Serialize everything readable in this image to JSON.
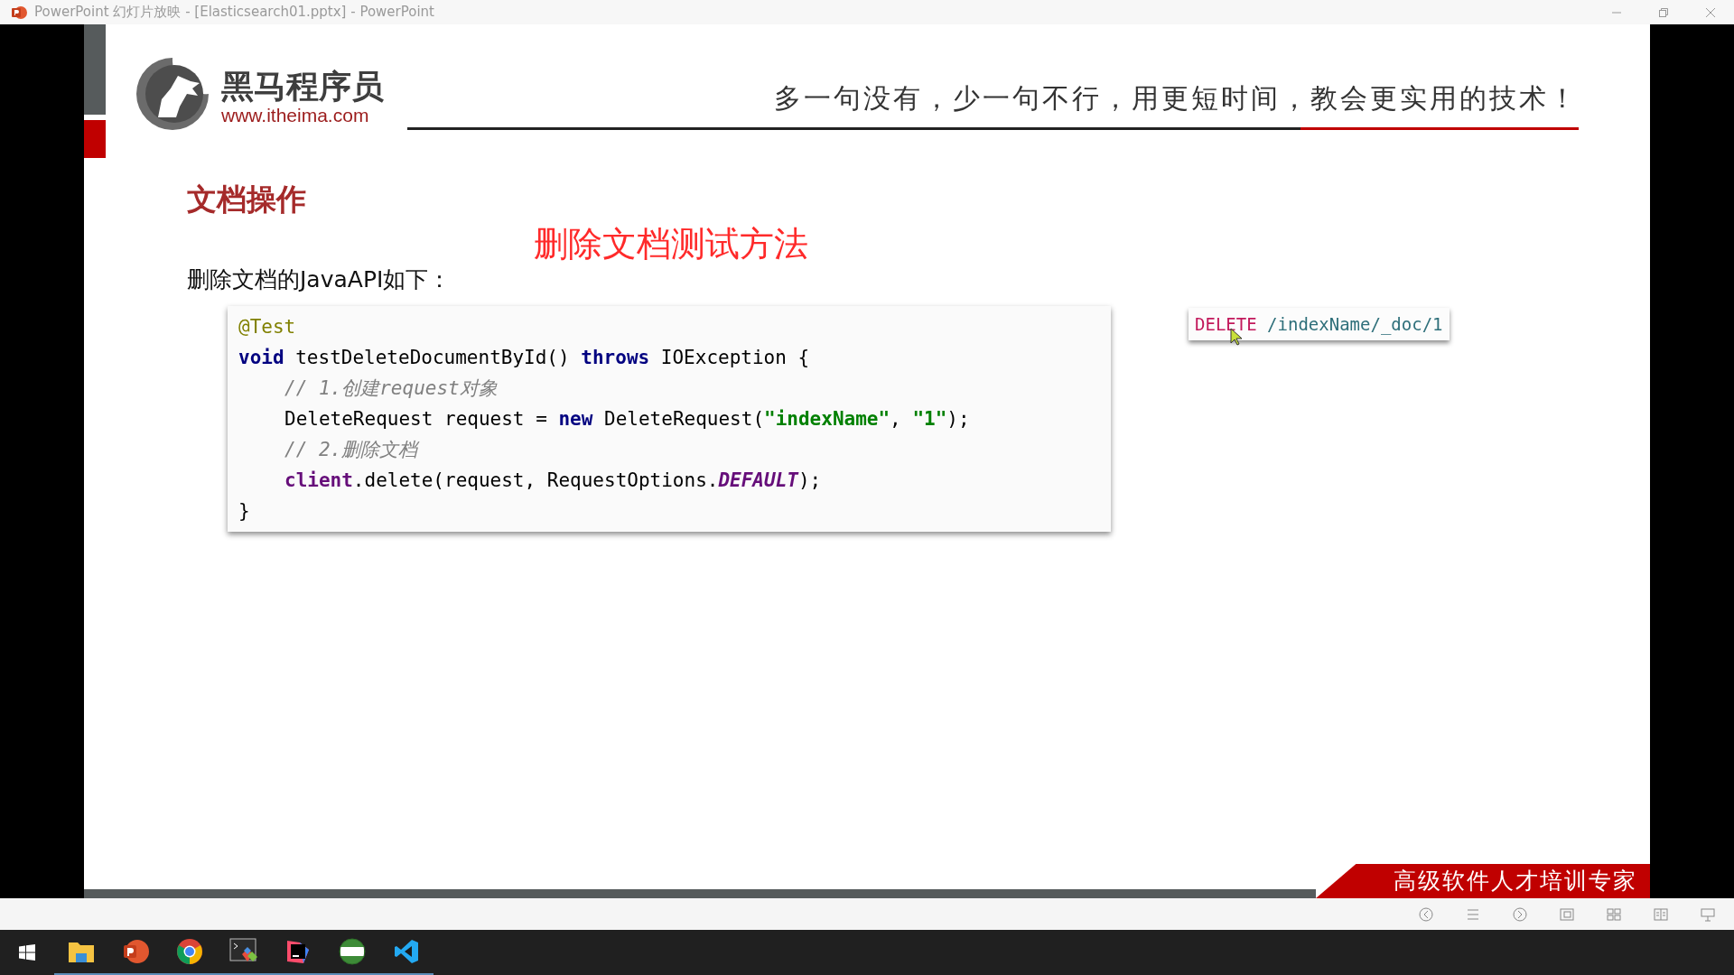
{
  "window": {
    "title": "PowerPoint 幻灯片放映 - [Elasticsearch01.pptx] - PowerPoint"
  },
  "slide": {
    "brand_name": "黑马程序员",
    "brand_url": "www.itheima.com",
    "slogan": "多一句没有，少一句不行，用更短时间，教会更实用的技术！",
    "heading": "文档操作",
    "annotation": "删除文档测试方法",
    "intro": "删除文档的JavaAPI如下：",
    "code": [
      {
        "indented": false,
        "tokens": [
          {
            "kind": "annotation",
            "text": "@Test"
          }
        ]
      },
      {
        "indented": false,
        "tokens": [
          {
            "kind": "keyword",
            "text": "void"
          },
          {
            "kind": "plain",
            "text": " testDeleteDocumentById() "
          },
          {
            "kind": "keyword",
            "text": "throws"
          },
          {
            "kind": "plain",
            "text": " IOException {"
          }
        ]
      },
      {
        "indented": true,
        "tokens": [
          {
            "kind": "comment",
            "text": "// 1.创建request对象"
          }
        ]
      },
      {
        "indented": true,
        "tokens": [
          {
            "kind": "plain",
            "text": "DeleteRequest request = "
          },
          {
            "kind": "keyword",
            "text": "new"
          },
          {
            "kind": "plain",
            "text": " DeleteRequest("
          },
          {
            "kind": "string",
            "text": "\"indexName\""
          },
          {
            "kind": "plain",
            "text": ", "
          },
          {
            "kind": "string",
            "text": "\"1\""
          },
          {
            "kind": "plain",
            "text": ");"
          }
        ]
      },
      {
        "indented": true,
        "tokens": [
          {
            "kind": "comment",
            "text": "// 2.删除文档"
          }
        ]
      },
      {
        "indented": true,
        "tokens": [
          {
            "kind": "field",
            "text": "client"
          },
          {
            "kind": "plain",
            "text": ".delete(request, RequestOptions."
          },
          {
            "kind": "constant",
            "text": "DEFAULT"
          },
          {
            "kind": "plain",
            "text": ");"
          }
        ]
      },
      {
        "indented": false,
        "tokens": [
          {
            "kind": "plain",
            "text": "}"
          }
        ]
      }
    ],
    "request": {
      "method": "DELETE",
      "path": " /indexName/_doc/1"
    },
    "ribbon": "高级软件人才培训专家"
  },
  "taskbar": {
    "apps": [
      {
        "kind": "explorer",
        "selected": false
      },
      {
        "kind": "powerpoint",
        "selected": false
      },
      {
        "kind": "chrome",
        "selected": false
      },
      {
        "kind": "terminal",
        "selected": false
      },
      {
        "kind": "intellij",
        "selected": false
      },
      {
        "kind": "hs",
        "selected": false
      },
      {
        "kind": "vscode",
        "selected": false
      }
    ]
  }
}
